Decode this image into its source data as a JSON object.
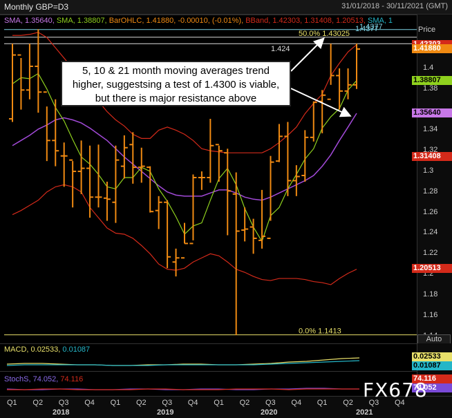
{
  "header": {
    "title": "Monthly GBP=D3",
    "date_range": "31/01/2018 - 30/11/2021 (GMT)"
  },
  "legend": {
    "sma1": "SMA, 1.35640,",
    "sma2": "SMA, 1.38807,",
    "barohlc": "BarOHLC, 1.41880, -0.00010, (-0.01%),",
    "bband": "BBand, 1.42303, 1.31408, 1.20513,",
    "sma3": "SMA, 1"
  },
  "annotation": {
    "line1": "5, 10 & 21 month moving averages trend",
    "line2": "higher, suggestsing a test of 1.4300 is viable,",
    "line3": "but there is major resistance above"
  },
  "price_axis": {
    "label": "Price",
    "ticks": [
      "1.4",
      "1.38",
      "1.34",
      "1.32",
      "1.3",
      "1.28",
      "1.26",
      "1.24",
      "1.22",
      "1.2",
      "1.18",
      "1.16",
      "1.14"
    ],
    "auto_label": "Auto"
  },
  "price_tags": [
    {
      "value": "1.4377",
      "color": "#7fd4e6",
      "text_color": "#7fd4e6",
      "bg": "none"
    },
    {
      "value": "1.42303",
      "color": "#ffffff",
      "text_color": "#ffffff",
      "bg": "#d42a1a"
    },
    {
      "value": "1.41880",
      "color": "#ffffff",
      "text_color": "#ffffff",
      "bg": "#f08a12"
    },
    {
      "value": "1.38807",
      "color": "#000000",
      "text_color": "#000000",
      "bg": "#8fd11e"
    },
    {
      "value": "1.35640",
      "color": "#000000",
      "text_color": "#000000",
      "bg": "#c878e8"
    },
    {
      "value": "1.31408",
      "color": "#ffffff",
      "text_color": "#ffffff",
      "bg": "#d42a1a"
    },
    {
      "value": "1.20513",
      "color": "#ffffff",
      "text_color": "#ffffff",
      "bg": "#d42a1a"
    }
  ],
  "levels": {
    "high_label": "1.424",
    "fib50": "50.0% 1.43025",
    "fib0": "0.0% 1.1413",
    "hline_4377": "1.4377"
  },
  "macd": {
    "legend_name": "MACD,",
    "v1": "0.02533,",
    "v2": "0.01087",
    "tag1": "0.02533",
    "tag2": "0.01087"
  },
  "stoch": {
    "legend_name": "StochS,",
    "v1": "74.052,",
    "v2": "74.116",
    "tag1": "74.116",
    "tag2": "74.052"
  },
  "xaxis": {
    "quarters": [
      "Q1",
      "Q2",
      "Q3",
      "Q4",
      "Q1",
      "Q2",
      "Q3",
      "Q4",
      "Q1",
      "Q2",
      "Q3",
      "Q4",
      "Q1",
      "Q2",
      "Q3",
      "Q4"
    ],
    "years": [
      "2018",
      "2019",
      "2020",
      "2021"
    ]
  },
  "watermark": "FX678",
  "colors": {
    "bars": "#f08a12",
    "sma5": "#8fd11e",
    "sma21": "#a24ad8",
    "bbands": "#d42a1a",
    "fib": "#e8e06a",
    "macd": "#e8e06a",
    "signal": "#24b6c8",
    "stoch_k": "#7a4ad8",
    "stoch_d": "#d42a1a"
  },
  "chart_data": {
    "type": "ohlc",
    "title": "Monthly GBP=D3",
    "x": [
      "2018-01",
      "2018-02",
      "2018-03",
      "2018-04",
      "2018-05",
      "2018-06",
      "2018-07",
      "2018-08",
      "2018-09",
      "2018-10",
      "2018-11",
      "2018-12",
      "2019-01",
      "2019-02",
      "2019-03",
      "2019-04",
      "2019-05",
      "2019-06",
      "2019-07",
      "2019-08",
      "2019-09",
      "2019-10",
      "2019-11",
      "2019-12",
      "2020-01",
      "2020-02",
      "2020-03",
      "2020-04",
      "2020-05",
      "2020-06",
      "2020-07",
      "2020-08",
      "2020-09",
      "2020-10",
      "2020-11",
      "2020-12",
      "2021-01",
      "2021-02",
      "2021-03",
      "2021-04",
      "2021-05"
    ],
    "open": [
      1.351,
      1.413,
      1.379,
      1.402,
      1.377,
      1.33,
      1.315,
      1.311,
      1.3,
      1.303,
      1.275,
      1.274,
      1.27,
      1.305,
      1.326,
      1.304,
      1.304,
      1.262,
      1.27,
      1.212,
      1.216,
      1.23,
      1.294,
      1.294,
      1.326,
      1.318,
      1.278,
      1.243,
      1.246,
      1.233,
      1.235,
      1.31,
      1.334,
      1.291,
      1.296,
      1.333,
      1.368,
      1.37,
      1.393,
      1.378,
      1.384
    ],
    "high": [
      1.424,
      1.41,
      1.424,
      1.438,
      1.363,
      1.37,
      1.328,
      1.31,
      1.33,
      1.325,
      1.326,
      1.29,
      1.325,
      1.335,
      1.338,
      1.323,
      1.305,
      1.276,
      1.272,
      1.225,
      1.25,
      1.297,
      1.3,
      1.351,
      1.325,
      1.322,
      1.299,
      1.265,
      1.254,
      1.282,
      1.315,
      1.346,
      1.348,
      1.306,
      1.34,
      1.368,
      1.379,
      1.424,
      1.4,
      1.4,
      1.424
    ],
    "low": [
      1.348,
      1.36,
      1.37,
      1.357,
      1.31,
      1.305,
      1.285,
      1.265,
      1.278,
      1.255,
      1.265,
      1.252,
      1.25,
      1.293,
      1.288,
      1.289,
      1.26,
      1.244,
      1.206,
      1.198,
      1.23,
      1.233,
      1.282,
      1.289,
      1.29,
      1.238,
      1.141,
      1.232,
      1.22,
      1.225,
      1.252,
      1.309,
      1.276,
      1.276,
      1.29,
      1.329,
      1.337,
      1.384,
      1.36,
      1.37,
      1.38
    ],
    "close": [
      1.413,
      1.379,
      1.402,
      1.377,
      1.33,
      1.32,
      1.315,
      1.3,
      1.303,
      1.275,
      1.275,
      1.273,
      1.311,
      1.323,
      1.304,
      1.305,
      1.261,
      1.27,
      1.217,
      1.216,
      1.23,
      1.294,
      1.294,
      1.325,
      1.32,
      1.281,
      1.242,
      1.244,
      1.235,
      1.237,
      1.309,
      1.334,
      1.291,
      1.295,
      1.333,
      1.367,
      1.374,
      1.393,
      1.378,
      1.384,
      1.4188
    ],
    "sma5": [
      1.385,
      1.391,
      1.39,
      1.395,
      1.38,
      1.362,
      1.349,
      1.331,
      1.314,
      1.307,
      1.297,
      1.285,
      1.283,
      1.294,
      1.294,
      1.304,
      1.3,
      1.283,
      1.271,
      1.256,
      1.239,
      1.247,
      1.25,
      1.272,
      1.293,
      1.303,
      1.287,
      1.264,
      1.246,
      1.232,
      1.257,
      1.265,
      1.283,
      1.297,
      1.312,
      1.322,
      1.342,
      1.353,
      1.361,
      1.379,
      1.3881
    ],
    "sma21": [
      1.325,
      1.33,
      1.335,
      1.341,
      1.345,
      1.35,
      1.352,
      1.35,
      1.347,
      1.342,
      1.336,
      1.33,
      1.322,
      1.314,
      1.307,
      1.3,
      1.293,
      1.286,
      1.28,
      1.277,
      1.276,
      1.276,
      1.276,
      1.279,
      1.282,
      1.282,
      1.279,
      1.275,
      1.273,
      1.272,
      1.275,
      1.279,
      1.283,
      1.287,
      1.291,
      1.296,
      1.305,
      1.316,
      1.33,
      1.343,
      1.3564
    ],
    "bb_upper": [
      1.432,
      1.432,
      1.433,
      1.435,
      1.43,
      1.42,
      1.41,
      1.4,
      1.388,
      1.378,
      1.368,
      1.358,
      1.35,
      1.344,
      1.336,
      1.332,
      1.332,
      1.34,
      1.343,
      1.34,
      1.336,
      1.33,
      1.322,
      1.32,
      1.319,
      1.318,
      1.318,
      1.318,
      1.318,
      1.318,
      1.322,
      1.328,
      1.335,
      1.343,
      1.356,
      1.366,
      1.375,
      1.393,
      1.405,
      1.416,
      1.423
    ],
    "bb_lower": [
      1.258,
      1.262,
      1.267,
      1.272,
      1.28,
      1.285,
      1.287,
      1.285,
      1.28,
      1.265,
      1.255,
      1.245,
      1.24,
      1.239,
      1.235,
      1.228,
      1.22,
      1.21,
      1.205,
      1.204,
      1.206,
      1.212,
      1.216,
      1.22,
      1.218,
      1.212,
      1.205,
      1.202,
      1.198,
      1.195,
      1.194,
      1.196,
      1.196,
      1.196,
      1.195,
      1.193,
      1.192,
      1.19,
      1.196,
      1.201,
      1.205
    ],
    "ylim": [
      1.133,
      1.4523
    ],
    "hlines": [
      1.4377,
      1.43025,
      1.424,
      1.1413
    ]
  }
}
